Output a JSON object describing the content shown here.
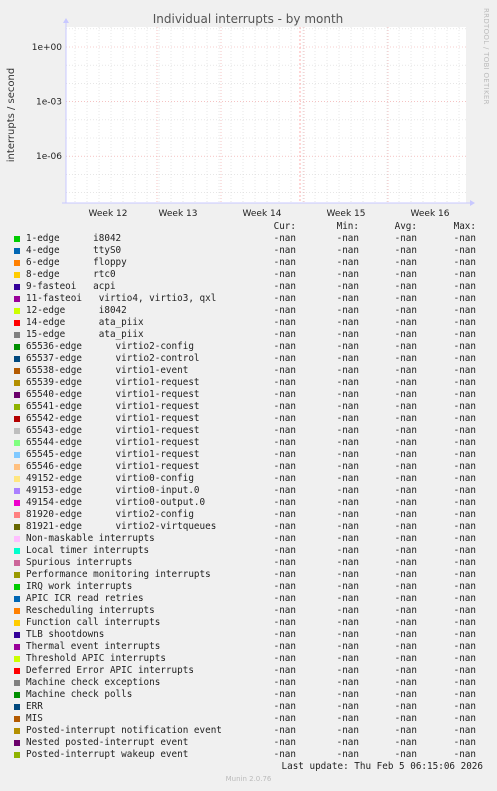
{
  "chart_data": {
    "type": "line",
    "title": "Individual interrupts - by month",
    "ylabel": "interrupts / second",
    "side_text": "RRDTOOL / TOBI OETIKER",
    "y_scale": "log",
    "y_ticks": [
      "1e+00",
      "1e-03",
      "1e-06"
    ],
    "x_ticks": [
      "Week 12",
      "Week 13",
      "Week 14",
      "Week 15",
      "Week 16"
    ],
    "grid": true,
    "columns": [
      "Cur:",
      "Min:",
      "Avg:",
      "Max:"
    ],
    "series": [
      {
        "name": "1-edge      i8042",
        "color": "#00cc00",
        "cur": "-nan",
        "min": "-nan",
        "avg": "-nan",
        "max": "-nan"
      },
      {
        "name": "4-edge      ttyS0",
        "color": "#0066b3",
        "cur": "-nan",
        "min": "-nan",
        "avg": "-nan",
        "max": "-nan"
      },
      {
        "name": "6-edge      floppy",
        "color": "#ff8000",
        "cur": "-nan",
        "min": "-nan",
        "avg": "-nan",
        "max": "-nan"
      },
      {
        "name": "8-edge      rtc0",
        "color": "#ffcc00",
        "cur": "-nan",
        "min": "-nan",
        "avg": "-nan",
        "max": "-nan"
      },
      {
        "name": "9-fasteoi   acpi",
        "color": "#330099",
        "cur": "-nan",
        "min": "-nan",
        "avg": "-nan",
        "max": "-nan"
      },
      {
        "name": "11-fasteoi   virtio4, virtio3, qxl",
        "color": "#990099",
        "cur": "-nan",
        "min": "-nan",
        "avg": "-nan",
        "max": "-nan"
      },
      {
        "name": "12-edge      i8042",
        "color": "#ccff00",
        "cur": "-nan",
        "min": "-nan",
        "avg": "-nan",
        "max": "-nan"
      },
      {
        "name": "14-edge      ata_piix",
        "color": "#ff0000",
        "cur": "-nan",
        "min": "-nan",
        "avg": "-nan",
        "max": "-nan"
      },
      {
        "name": "15-edge      ata_piix",
        "color": "#808080",
        "cur": "-nan",
        "min": "-nan",
        "avg": "-nan",
        "max": "-nan"
      },
      {
        "name": "65536-edge      virtio2-config",
        "color": "#008f00",
        "cur": "-nan",
        "min": "-nan",
        "avg": "-nan",
        "max": "-nan"
      },
      {
        "name": "65537-edge      virtio2-control",
        "color": "#00487d",
        "cur": "-nan",
        "min": "-nan",
        "avg": "-nan",
        "max": "-nan"
      },
      {
        "name": "65538-edge      virtio1-event",
        "color": "#b35a00",
        "cur": "-nan",
        "min": "-nan",
        "avg": "-nan",
        "max": "-nan"
      },
      {
        "name": "65539-edge      virtio1-request",
        "color": "#b38f00",
        "cur": "-nan",
        "min": "-nan",
        "avg": "-nan",
        "max": "-nan"
      },
      {
        "name": "65540-edge      virtio1-request",
        "color": "#6b006b",
        "cur": "-nan",
        "min": "-nan",
        "avg": "-nan",
        "max": "-nan"
      },
      {
        "name": "65541-edge      virtio1-request",
        "color": "#8fb300",
        "cur": "-nan",
        "min": "-nan",
        "avg": "-nan",
        "max": "-nan"
      },
      {
        "name": "65542-edge      virtio1-request",
        "color": "#b30000",
        "cur": "-nan",
        "min": "-nan",
        "avg": "-nan",
        "max": "-nan"
      },
      {
        "name": "65543-edge      virtio1-request",
        "color": "#bebebe",
        "cur": "-nan",
        "min": "-nan",
        "avg": "-nan",
        "max": "-nan"
      },
      {
        "name": "65544-edge      virtio1-request",
        "color": "#80ff80",
        "cur": "-nan",
        "min": "-nan",
        "avg": "-nan",
        "max": "-nan"
      },
      {
        "name": "65545-edge      virtio1-request",
        "color": "#80c9ff",
        "cur": "-nan",
        "min": "-nan",
        "avg": "-nan",
        "max": "-nan"
      },
      {
        "name": "65546-edge      virtio1-request",
        "color": "#ffc080",
        "cur": "-nan",
        "min": "-nan",
        "avg": "-nan",
        "max": "-nan"
      },
      {
        "name": "49152-edge      virtio0-config",
        "color": "#ffe680",
        "cur": "-nan",
        "min": "-nan",
        "avg": "-nan",
        "max": "-nan"
      },
      {
        "name": "49153-edge      virtio0-input.0",
        "color": "#aa80ff",
        "cur": "-nan",
        "min": "-nan",
        "avg": "-nan",
        "max": "-nan"
      },
      {
        "name": "49154-edge      virtio0-output.0",
        "color": "#ee00cc",
        "cur": "-nan",
        "min": "-nan",
        "avg": "-nan",
        "max": "-nan"
      },
      {
        "name": "81920-edge      virtio2-config",
        "color": "#ff8080",
        "cur": "-nan",
        "min": "-nan",
        "avg": "-nan",
        "max": "-nan"
      },
      {
        "name": "81921-edge      virtio2-virtqueues",
        "color": "#666600",
        "cur": "-nan",
        "min": "-nan",
        "avg": "-nan",
        "max": "-nan"
      },
      {
        "name": "Non-maskable interrupts",
        "color": "#ffbfff",
        "cur": "-nan",
        "min": "-nan",
        "avg": "-nan",
        "max": "-nan"
      },
      {
        "name": "Local timer interrupts",
        "color": "#00ffcc",
        "cur": "-nan",
        "min": "-nan",
        "avg": "-nan",
        "max": "-nan"
      },
      {
        "name": "Spurious interrupts",
        "color": "#cc6699",
        "cur": "-nan",
        "min": "-nan",
        "avg": "-nan",
        "max": "-nan"
      },
      {
        "name": "Performance monitoring interrupts",
        "color": "#999900",
        "cur": "-nan",
        "min": "-nan",
        "avg": "-nan",
        "max": "-nan"
      },
      {
        "name": "IRQ work interrupts",
        "color": "#00cc00",
        "cur": "-nan",
        "min": "-nan",
        "avg": "-nan",
        "max": "-nan"
      },
      {
        "name": "APIC ICR read retries",
        "color": "#0066b3",
        "cur": "-nan",
        "min": "-nan",
        "avg": "-nan",
        "max": "-nan"
      },
      {
        "name": "Rescheduling interrupts",
        "color": "#ff8000",
        "cur": "-nan",
        "min": "-nan",
        "avg": "-nan",
        "max": "-nan"
      },
      {
        "name": "Function call interrupts",
        "color": "#ffcc00",
        "cur": "-nan",
        "min": "-nan",
        "avg": "-nan",
        "max": "-nan"
      },
      {
        "name": "TLB shootdowns",
        "color": "#330099",
        "cur": "-nan",
        "min": "-nan",
        "avg": "-nan",
        "max": "-nan"
      },
      {
        "name": "Thermal event interrupts",
        "color": "#990099",
        "cur": "-nan",
        "min": "-nan",
        "avg": "-nan",
        "max": "-nan"
      },
      {
        "name": "Threshold APIC interrupts",
        "color": "#ccff00",
        "cur": "-nan",
        "min": "-nan",
        "avg": "-nan",
        "max": "-nan"
      },
      {
        "name": "Deferred Error APIC interrupts",
        "color": "#ff0000",
        "cur": "-nan",
        "min": "-nan",
        "avg": "-nan",
        "max": "-nan"
      },
      {
        "name": "Machine check exceptions",
        "color": "#808080",
        "cur": "-nan",
        "min": "-nan",
        "avg": "-nan",
        "max": "-nan"
      },
      {
        "name": "Machine check polls",
        "color": "#008f00",
        "cur": "-nan",
        "min": "-nan",
        "avg": "-nan",
        "max": "-nan"
      },
      {
        "name": "ERR",
        "color": "#00487d",
        "cur": "-nan",
        "min": "-nan",
        "avg": "-nan",
        "max": "-nan"
      },
      {
        "name": "MIS",
        "color": "#b35a00",
        "cur": "-nan",
        "min": "-nan",
        "avg": "-nan",
        "max": "-nan"
      },
      {
        "name": "Posted-interrupt notification event",
        "color": "#b38f00",
        "cur": "-nan",
        "min": "-nan",
        "avg": "-nan",
        "max": "-nan"
      },
      {
        "name": "Nested posted-interrupt event",
        "color": "#6b006b",
        "cur": "-nan",
        "min": "-nan",
        "avg": "-nan",
        "max": "-nan"
      },
      {
        "name": "Posted-interrupt wakeup event",
        "color": "#8fb300",
        "cur": "-nan",
        "min": "-nan",
        "avg": "-nan",
        "max": "-nan"
      }
    ]
  },
  "footer": {
    "last_update": "Last update: Thu Feb  5 06:15:06 2026",
    "munin": "Munin 2.0.76"
  }
}
